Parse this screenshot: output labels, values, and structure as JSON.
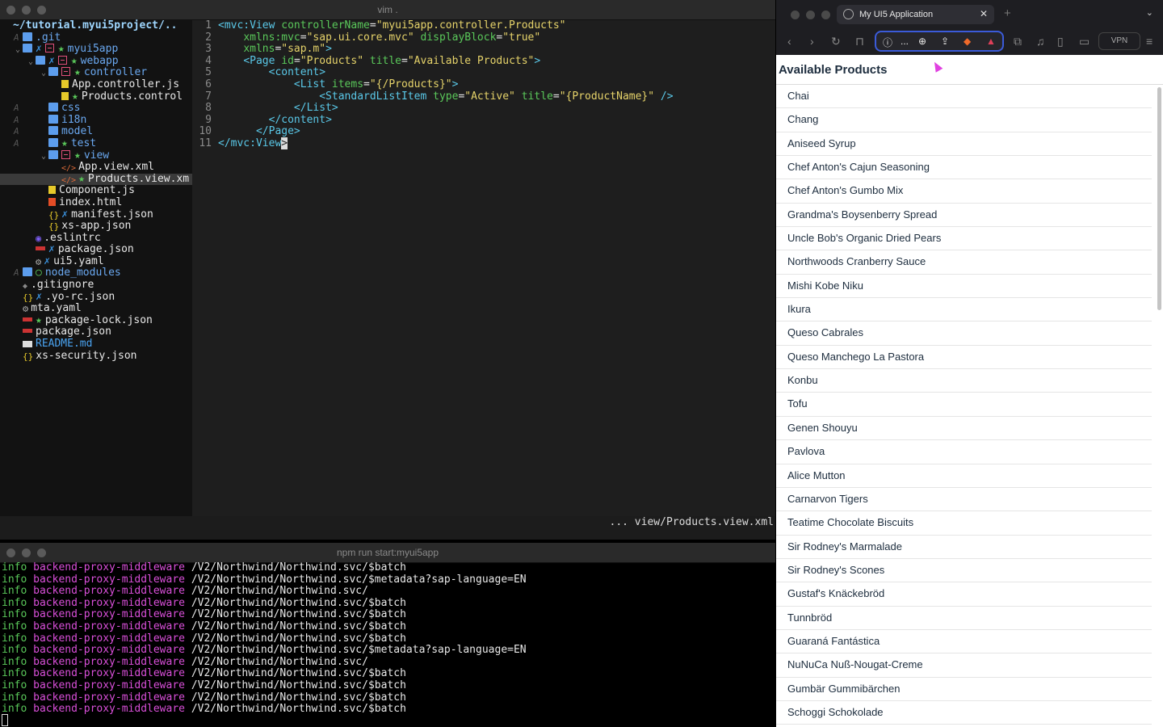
{
  "vim": {
    "title": "vim .",
    "tree": {
      "root": "~/tutorial.myui5project/..",
      "items": [
        {
          "mark": "A",
          "indent": 0,
          "chev": "",
          "gx": "",
          "gstar": "",
          "gmin": false,
          "icon": "folder",
          "label": ".git",
          "cls": "dirname"
        },
        {
          "mark": "",
          "indent": 0,
          "chev": "⌄",
          "gx": "✗",
          "gstar": "★",
          "gmin": true,
          "icon": "folder",
          "label": "myui5app",
          "cls": "dirname"
        },
        {
          "mark": "",
          "indent": 1,
          "chev": "⌄",
          "gx": "✗",
          "gstar": "★",
          "gmin": true,
          "icon": "folder",
          "label": "webapp",
          "cls": "dirname"
        },
        {
          "mark": "",
          "indent": 2,
          "chev": "⌄",
          "gx": "",
          "gstar": "★",
          "gmin": true,
          "icon": "folder",
          "label": "controller",
          "cls": "dirname"
        },
        {
          "mark": "",
          "indent": 3,
          "chev": "",
          "gx": "",
          "gstar": "",
          "gmin": false,
          "icon": "js",
          "label": "App.controller.js",
          "cls": ""
        },
        {
          "mark": "",
          "indent": 3,
          "chev": "",
          "gx": "",
          "gstar": "★",
          "gmin": false,
          "icon": "js",
          "label": "Products.control",
          "cls": ""
        },
        {
          "mark": "A",
          "indent": 2,
          "chev": "",
          "gx": "",
          "gstar": "",
          "gmin": false,
          "icon": "folder",
          "label": "css",
          "cls": "dirname"
        },
        {
          "mark": "A",
          "indent": 2,
          "chev": "",
          "gx": "",
          "gstar": "",
          "gmin": false,
          "icon": "folder",
          "label": "i18n",
          "cls": "dirname"
        },
        {
          "mark": "A",
          "indent": 2,
          "chev": "",
          "gx": "",
          "gstar": "",
          "gmin": false,
          "icon": "folder",
          "label": "model",
          "cls": "dirname"
        },
        {
          "mark": "A",
          "indent": 2,
          "chev": "",
          "gx": "",
          "gstar": "★",
          "gmin": false,
          "icon": "folder",
          "label": "test",
          "cls": "dirname"
        },
        {
          "mark": "",
          "indent": 2,
          "chev": "⌄",
          "gx": "",
          "gstar": "★",
          "gmin": true,
          "icon": "folder",
          "label": "view",
          "cls": "dirname"
        },
        {
          "mark": "",
          "indent": 3,
          "chev": "",
          "gx": "",
          "gstar": "",
          "gmin": false,
          "icon": "xml",
          "label": "App.view.xml",
          "cls": ""
        },
        {
          "mark": "",
          "indent": 3,
          "chev": "",
          "gx": "",
          "gstar": "★",
          "gmin": false,
          "icon": "xml",
          "label": "Products.view.xm",
          "cls": "",
          "sel": true
        },
        {
          "mark": "",
          "indent": 2,
          "chev": "",
          "gx": "",
          "gstar": "",
          "gmin": false,
          "icon": "js",
          "label": "Component.js",
          "cls": ""
        },
        {
          "mark": "",
          "indent": 2,
          "chev": "",
          "gx": "",
          "gstar": "",
          "gmin": false,
          "icon": "html",
          "label": "index.html",
          "cls": ""
        },
        {
          "mark": "",
          "indent": 2,
          "chev": "",
          "gx": "✗",
          "gstar": "",
          "gmin": false,
          "icon": "json",
          "label": "manifest.json",
          "cls": ""
        },
        {
          "mark": "",
          "indent": 2,
          "chev": "",
          "gx": "",
          "gstar": "",
          "gmin": false,
          "icon": "json",
          "label": "xs-app.json",
          "cls": ""
        },
        {
          "mark": "",
          "indent": 1,
          "chev": "",
          "gx": "",
          "gstar": "",
          "gmin": false,
          "icon": "ring",
          "label": ".eslintrc",
          "cls": ""
        },
        {
          "mark": "",
          "indent": 1,
          "chev": "",
          "gx": "✗",
          "gstar": "",
          "gmin": false,
          "icon": "npm",
          "label": "package.json",
          "cls": ""
        },
        {
          "mark": "",
          "indent": 1,
          "chev": "",
          "gx": "✗",
          "gstar": "",
          "gmin": false,
          "icon": "gear",
          "label": "ui5.yaml",
          "cls": ""
        },
        {
          "mark": "A",
          "indent": 0,
          "chev": "",
          "gx": "",
          "gstar": "○",
          "gmin": false,
          "icon": "folder",
          "label": "node_modules",
          "cls": "modname"
        },
        {
          "mark": "",
          "indent": 0,
          "chev": "",
          "gx": "",
          "gstar": "",
          "gmin": false,
          "icon": "gitdot",
          "label": ".gitignore",
          "cls": ""
        },
        {
          "mark": "",
          "indent": 0,
          "chev": "",
          "gx": "✗",
          "gstar": "",
          "gmin": false,
          "icon": "json",
          "label": ".yo-rc.json",
          "cls": ""
        },
        {
          "mark": "",
          "indent": 0,
          "chev": "",
          "gx": "",
          "gstar": "",
          "gmin": false,
          "icon": "gear",
          "label": "mta.yaml",
          "cls": ""
        },
        {
          "mark": "",
          "indent": 0,
          "chev": "",
          "gx": "",
          "gstar": "★",
          "gmin": false,
          "icon": "npm",
          "label": "package-lock.json",
          "cls": ""
        },
        {
          "mark": "",
          "indent": 0,
          "chev": "",
          "gx": "",
          "gstar": "",
          "gmin": false,
          "icon": "npm",
          "label": "package.json",
          "cls": ""
        },
        {
          "mark": "",
          "indent": 0,
          "chev": "",
          "gx": "",
          "gstar": "",
          "gmin": false,
          "icon": "md",
          "label": "README.md",
          "cls": "mdname"
        },
        {
          "mark": "",
          "indent": 0,
          "chev": "",
          "gx": "",
          "gstar": "",
          "gmin": false,
          "icon": "json",
          "label": "xs-security.json",
          "cls": ""
        }
      ]
    },
    "editor": {
      "lines": [
        {
          "n": "1",
          "parts": [
            [
              "t-tag",
              "<mvc:View "
            ],
            [
              "t-attr",
              "controllerName"
            ],
            [
              "code",
              "="
            ],
            [
              "t-str",
              "\"myui5app.controller.Products\""
            ]
          ]
        },
        {
          "n": "2",
          "parts": [
            [
              "code",
              "    "
            ],
            [
              "t-attr",
              "xmlns:mvc"
            ],
            [
              "code",
              "="
            ],
            [
              "t-str",
              "\"sap.ui.core.mvc\""
            ],
            [
              "code",
              " "
            ],
            [
              "t-attr",
              "displayBlock"
            ],
            [
              "code",
              "="
            ],
            [
              "t-str",
              "\"true\""
            ]
          ]
        },
        {
          "n": "3",
          "parts": [
            [
              "code",
              "    "
            ],
            [
              "t-attr",
              "xmlns"
            ],
            [
              "code",
              "="
            ],
            [
              "t-str",
              "\"sap.m\""
            ],
            [
              "t-tag",
              ">"
            ]
          ]
        },
        {
          "n": "4",
          "parts": [
            [
              "code",
              "    "
            ],
            [
              "t-tag",
              "<Page "
            ],
            [
              "t-attr",
              "id"
            ],
            [
              "code",
              "="
            ],
            [
              "t-str",
              "\"Products\""
            ],
            [
              "code",
              " "
            ],
            [
              "t-attr",
              "title"
            ],
            [
              "code",
              "="
            ],
            [
              "t-str",
              "\"Available Products\""
            ],
            [
              "t-tag",
              ">"
            ]
          ]
        },
        {
          "n": "5",
          "parts": [
            [
              "code",
              "        "
            ],
            [
              "t-tag",
              "<content>"
            ]
          ]
        },
        {
          "n": "6",
          "parts": [
            [
              "code",
              "            "
            ],
            [
              "t-tag",
              "<List "
            ],
            [
              "t-attr",
              "items"
            ],
            [
              "code",
              "="
            ],
            [
              "t-str",
              "\"{/Products}\""
            ],
            [
              "t-tag",
              ">"
            ]
          ]
        },
        {
          "n": "7",
          "parts": [
            [
              "code",
              "                "
            ],
            [
              "t-tag",
              "<StandardListItem "
            ],
            [
              "t-attr",
              "type"
            ],
            [
              "code",
              "="
            ],
            [
              "t-str",
              "\"Active\""
            ],
            [
              "code",
              " "
            ],
            [
              "t-attr",
              "title"
            ],
            [
              "code",
              "="
            ],
            [
              "t-str",
              "\"{ProductName}\""
            ],
            [
              "t-tag",
              " />"
            ]
          ]
        },
        {
          "n": "8",
          "parts": [
            [
              "code",
              "            "
            ],
            [
              "t-tag",
              "</List>"
            ]
          ]
        },
        {
          "n": "9",
          "parts": [
            [
              "code",
              "        "
            ],
            [
              "t-tag",
              "</content>"
            ]
          ]
        },
        {
          "n": "10",
          "parts": [
            [
              "code",
              "      "
            ],
            [
              "t-tag",
              "</Page>"
            ]
          ]
        },
        {
          "n": "11",
          "parts": [
            [
              "t-tag",
              "</mvc:View"
            ],
            [
              "cursor",
              ">"
            ]
          ]
        }
      ]
    },
    "statusline": "... view/Products.view.xml"
  },
  "terminal": {
    "title": "npm run start:myui5app",
    "lines": [
      [
        "info",
        "backend-proxy-middleware",
        "/V2/Northwind/Northwind.svc/$batch"
      ],
      [
        "info",
        "backend-proxy-middleware",
        "/V2/Northwind/Northwind.svc/$metadata?sap-language=EN"
      ],
      [
        "info",
        "backend-proxy-middleware",
        "/V2/Northwind/Northwind.svc/"
      ],
      [
        "info",
        "backend-proxy-middleware",
        "/V2/Northwind/Northwind.svc/$batch"
      ],
      [
        "info",
        "backend-proxy-middleware",
        "/V2/Northwind/Northwind.svc/$batch"
      ],
      [
        "info",
        "backend-proxy-middleware",
        "/V2/Northwind/Northwind.svc/$batch"
      ],
      [
        "info",
        "backend-proxy-middleware",
        "/V2/Northwind/Northwind.svc/$batch"
      ],
      [
        "info",
        "backend-proxy-middleware",
        "/V2/Northwind/Northwind.svc/$metadata?sap-language=EN"
      ],
      [
        "info",
        "backend-proxy-middleware",
        "/V2/Northwind/Northwind.svc/"
      ],
      [
        "info",
        "backend-proxy-middleware",
        "/V2/Northwind/Northwind.svc/$batch"
      ],
      [
        "info",
        "backend-proxy-middleware",
        "/V2/Northwind/Northwind.svc/$batch"
      ],
      [
        "info",
        "backend-proxy-middleware",
        "/V2/Northwind/Northwind.svc/$batch"
      ],
      [
        "info",
        "backend-proxy-middleware",
        "/V2/Northwind/Northwind.svc/$batch"
      ]
    ]
  },
  "browser": {
    "tab_title": "My UI5 Application",
    "tab_close": "✕",
    "new_tab": "+",
    "vpn_label": "VPN",
    "url_dots": "...",
    "page_title": "Available Products",
    "products": [
      "Chai",
      "Chang",
      "Aniseed Syrup",
      "Chef Anton's Cajun Seasoning",
      "Chef Anton's Gumbo Mix",
      "Grandma's Boysenberry Spread",
      "Uncle Bob's Organic Dried Pears",
      "Northwoods Cranberry Sauce",
      "Mishi Kobe Niku",
      "Ikura",
      "Queso Cabrales",
      "Queso Manchego La Pastora",
      "Konbu",
      "Tofu",
      "Genen Shouyu",
      "Pavlova",
      "Alice Mutton",
      "Carnarvon Tigers",
      "Teatime Chocolate Biscuits",
      "Sir Rodney's Marmalade",
      "Sir Rodney's Scones",
      "Gustaf's Knäckebröd",
      "Tunnbröd",
      "Guaraná Fantástica",
      "NuNuCa Nuß-Nougat-Creme",
      "Gumbär Gummibärchen",
      "Schoggi Schokolade"
    ],
    "icons": [
      "back-icon",
      "forward-icon",
      "reload-icon",
      "bookmark-icon",
      "info-icon",
      "zoom-icon",
      "share-icon",
      "brave-shields-icon",
      "brave-rewards-icon",
      "extensions-icon",
      "media-icon",
      "sidebar-icon",
      "wallet-icon",
      "menu-icon"
    ]
  }
}
